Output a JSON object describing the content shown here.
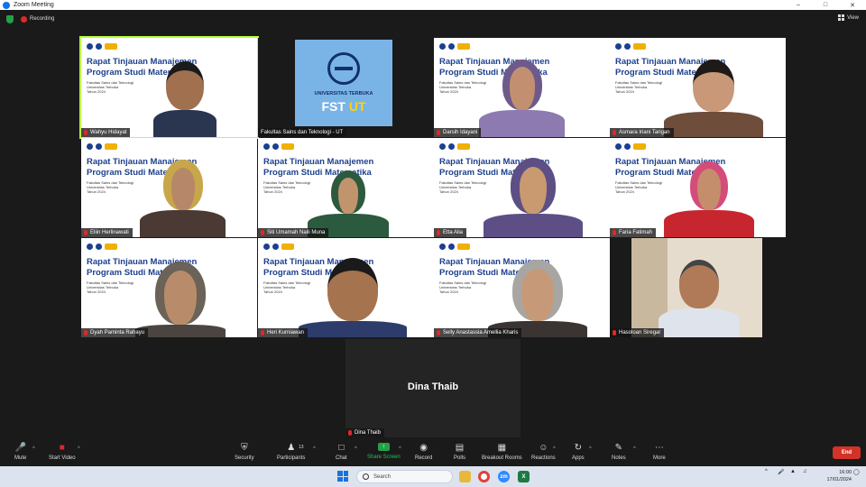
{
  "window": {
    "title": "Zoom Meeting"
  },
  "infobar": {
    "recording_label": "Recording",
    "view_label": "View"
  },
  "slide": {
    "line1": "Rapat Tinjauan Manajemen",
    "line2": "Program Studi Matematika",
    "sub1": "Fakultas Sains dan Teknologi",
    "sub2": "Universitas Terbuka",
    "sub3": "Tahun 2024"
  },
  "fst_logo": {
    "university": "UNIVERSITAS TERBUKA",
    "fst": "FST",
    "ut": "UT"
  },
  "participants": [
    {
      "name": "Wahyu Hidayat",
      "muted": true,
      "active": true
    },
    {
      "name": "Fakultas Sains dan Teknologi - UT",
      "muted": false,
      "active": false
    },
    {
      "name": "Darsih Idayani",
      "muted": true,
      "active": false
    },
    {
      "name": "Asmara Iriani Tarigan",
      "muted": true,
      "active": false
    },
    {
      "name": "Eliin Herlinawati",
      "muted": true,
      "active": false
    },
    {
      "name": "Siti Umamah Naili Muna",
      "muted": true,
      "active": false
    },
    {
      "name": "Etta Alia",
      "muted": true,
      "active": false
    },
    {
      "name": "Faria Fatimah",
      "muted": true,
      "active": false
    },
    {
      "name": "Dyah Paminta Rahayu",
      "muted": true,
      "active": false
    },
    {
      "name": "Heri Kurniawan",
      "muted": true,
      "active": false
    },
    {
      "name": "Selly Anastassia Amellia Kharis",
      "muted": true,
      "active": false
    },
    {
      "name": "Hasoloan Siregar",
      "muted": true,
      "active": false
    }
  ],
  "center_tile": {
    "name": "Dina Thaib"
  },
  "controls": {
    "mute": "Mute",
    "start_video": "Start Video",
    "security": "Security",
    "participants": "Participants",
    "participants_count": "13",
    "chat": "Chat",
    "share_screen": "Share Screen",
    "record": "Record",
    "polls": "Polls",
    "breakout_rooms": "Breakout Rooms",
    "reactions": "Reactions",
    "apps": "Apps",
    "notes": "Notes",
    "more": "More",
    "end": "End"
  },
  "taskbar": {
    "search_placeholder": "Search",
    "time": "16:00",
    "date": "17/01/2024"
  },
  "colors": {
    "active_speaker": "#b6ff3c",
    "end_button": "#d23228",
    "share_green": "#24a148",
    "slide_title": "#1c3f8e"
  }
}
